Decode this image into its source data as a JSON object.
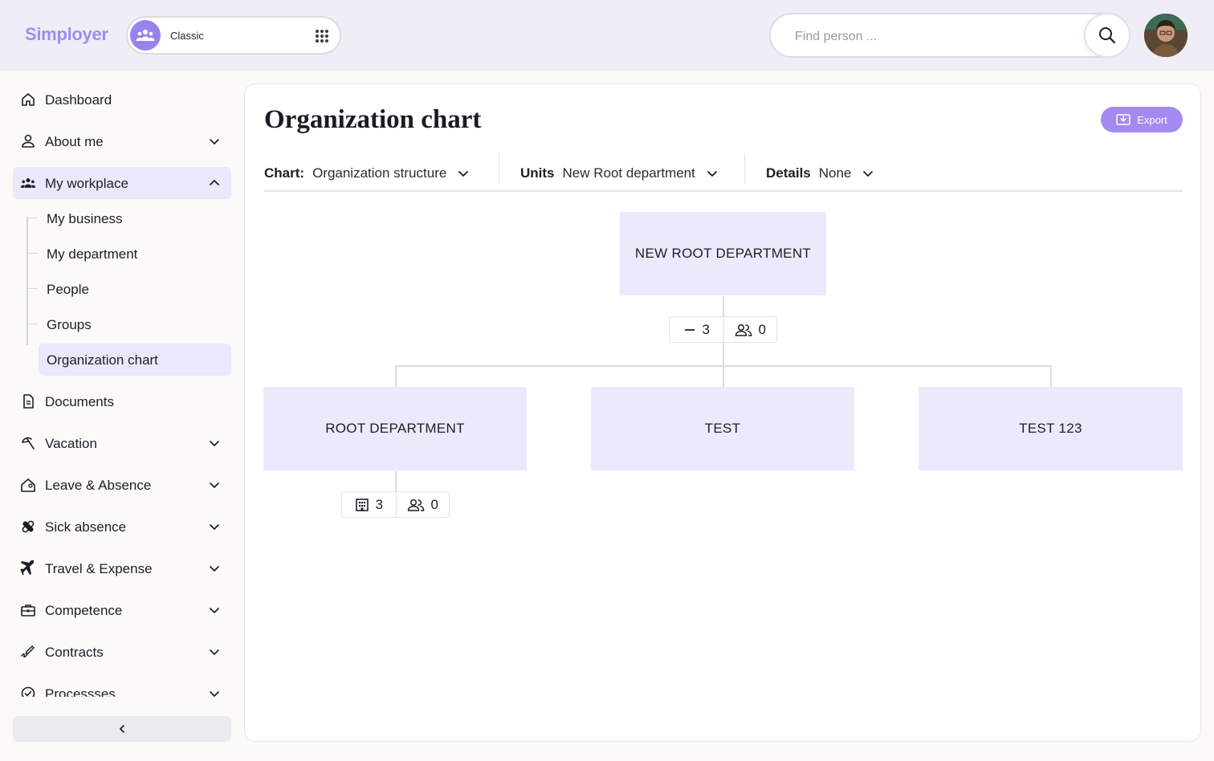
{
  "app": {
    "logo": "Simployer"
  },
  "header": {
    "mode_label": "Classic",
    "search_placeholder": "Find person ..."
  },
  "sidebar": {
    "items": [
      {
        "label": "Dashboard",
        "icon": "home-icon",
        "expandable": false
      },
      {
        "label": "About me",
        "icon": "user-icon",
        "expandable": true
      },
      {
        "label": "My workplace",
        "icon": "team-icon",
        "expandable": true,
        "expanded": true
      },
      {
        "label": "Documents",
        "icon": "document-icon",
        "expandable": false
      },
      {
        "label": "Vacation",
        "icon": "beach-icon",
        "expandable": true
      },
      {
        "label": "Leave & Absence",
        "icon": "house-person-icon",
        "expandable": true
      },
      {
        "label": "Sick absence",
        "icon": "bandage-icon",
        "expandable": true
      },
      {
        "label": "Travel & Expense",
        "icon": "plane-icon",
        "expandable": true
      },
      {
        "label": "Competence",
        "icon": "toolbox-icon",
        "expandable": true
      },
      {
        "label": "Contracts",
        "icon": "signature-icon",
        "expandable": true
      },
      {
        "label": "Processses",
        "icon": "check-circle-icon",
        "expandable": true
      }
    ],
    "workplace_subitems": [
      {
        "label": "My business"
      },
      {
        "label": "My department"
      },
      {
        "label": "People"
      },
      {
        "label": "Groups"
      },
      {
        "label": "Organization chart",
        "current": true
      }
    ]
  },
  "main": {
    "title": "Organization chart",
    "export_label": "Export",
    "filters": [
      {
        "key": "Chart:",
        "value": "Organization structure"
      },
      {
        "key": "Units",
        "value": "New Root department"
      },
      {
        "key": "Details",
        "value": "None"
      }
    ],
    "org_chart": {
      "root": {
        "name": "NEW ROOT DEPARTMENT",
        "subunits": "3",
        "people": "0"
      },
      "children": [
        {
          "name": "ROOT DEPARTMENT",
          "subunits": "3",
          "people": "0"
        },
        {
          "name": "TEST"
        },
        {
          "name": "TEST 123"
        }
      ]
    }
  },
  "colors": {
    "accent": "#a48af0",
    "node_bg": "#ece9fc",
    "header_bg": "#efeef6",
    "active_nav_bg": "#ebe8fb"
  }
}
